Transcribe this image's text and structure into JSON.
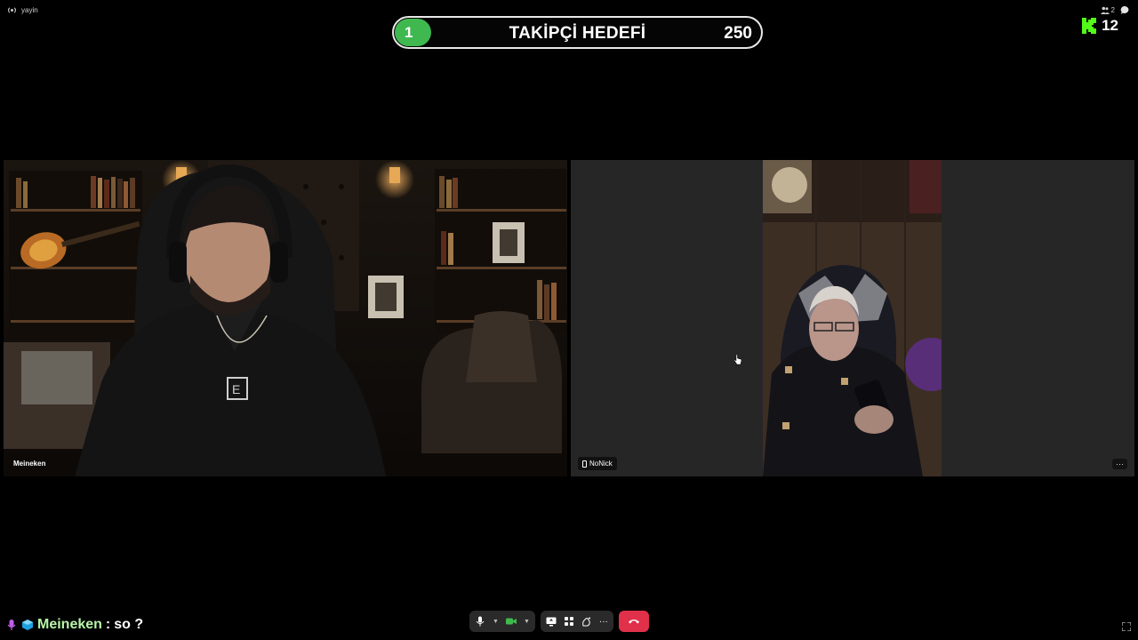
{
  "channel": {
    "name": "yayin",
    "icon": "broadcast-icon"
  },
  "goal": {
    "current": "1",
    "title": "TAKİPÇİ HEDEFİ",
    "target": "250",
    "progress_fraction": 0.1,
    "fill_color": "#3fb94f"
  },
  "top_right": {
    "participants_count": "2",
    "participants_icon": "people-icon",
    "chat_icon": "chat-bubble-icon",
    "kick_logo": "kick-logo",
    "viewer_count": "12",
    "kick_color": "#53fc18"
  },
  "tiles": [
    {
      "name": "Meineken"
    },
    {
      "name": "NoNick",
      "device_icon": "phone-icon",
      "menu": "···"
    }
  ],
  "chat": {
    "badges": [
      "microphone-badge-icon",
      "cube-badge-icon"
    ],
    "user": "Meineken",
    "separator": ":",
    "message": "so ?"
  },
  "controls": {
    "mic_icon": "microphone-icon",
    "camera_icon": "camera-icon",
    "screen_share_icon": "screen-share-icon",
    "grid_icon": "grid-icon",
    "reactions_icon": "reaction-icon",
    "more_label": "···",
    "leave_icon": "hang-up-icon",
    "leave_color": "#e0304a",
    "camera_color": "#3fb94f"
  }
}
